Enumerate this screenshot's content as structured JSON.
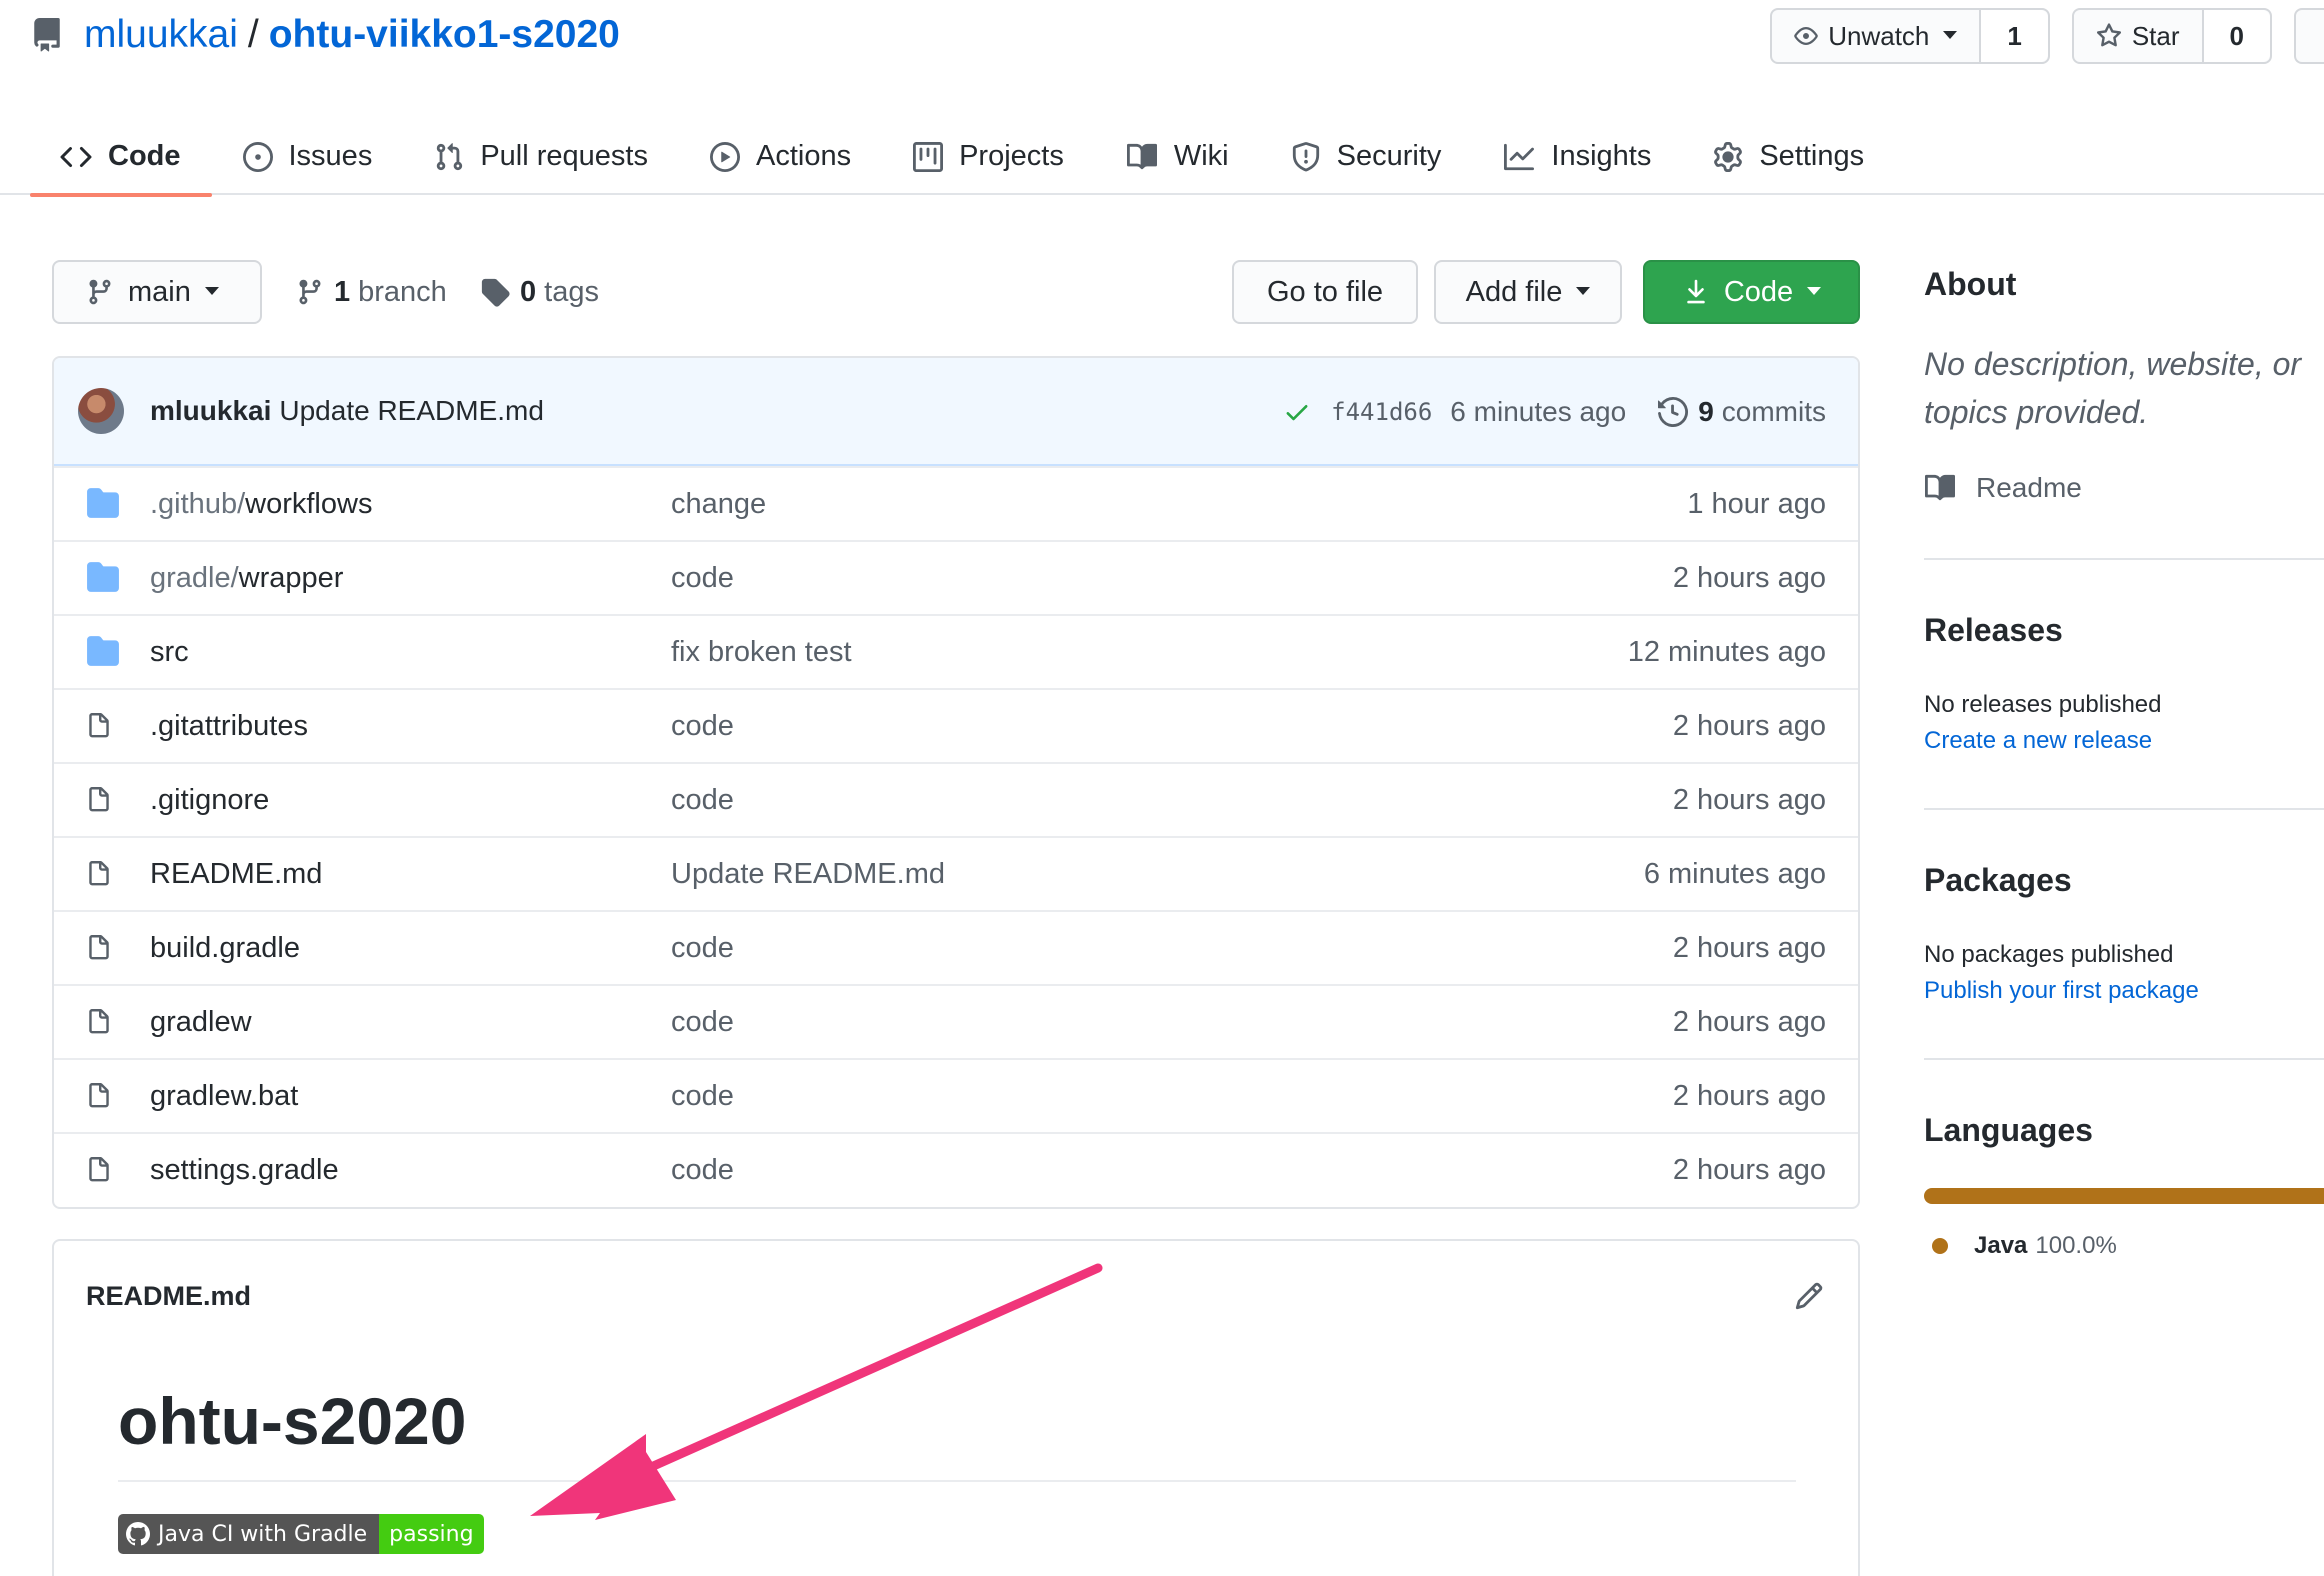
{
  "colors": {
    "link": "#0366d6",
    "primary_button": "#2ea44f",
    "tab_underline": "#f9826c",
    "commit_bar": "#f1f8ff",
    "folder_icon": "#79b8ff",
    "java": "#b07219",
    "badge_pass": "#44cc11",
    "annotation_arrow": "#f0357a"
  },
  "repo": {
    "owner": "mluukkai",
    "separator": "/",
    "name": "ohtu-viikko1-s2020"
  },
  "header_actions": {
    "watch_label": "Unwatch",
    "watch_count": "1",
    "star_label": "Star",
    "star_count": "0"
  },
  "tabs": [
    {
      "label": "Code",
      "icon": "code-icon",
      "selected": true
    },
    {
      "label": "Issues",
      "icon": "issue-icon"
    },
    {
      "label": "Pull requests",
      "icon": "pull-request-icon"
    },
    {
      "label": "Actions",
      "icon": "play-icon"
    },
    {
      "label": "Projects",
      "icon": "project-icon"
    },
    {
      "label": "Wiki",
      "icon": "book-icon"
    },
    {
      "label": "Security",
      "icon": "shield-icon"
    },
    {
      "label": "Insights",
      "icon": "graph-icon"
    },
    {
      "label": "Settings",
      "icon": "gear-icon"
    }
  ],
  "toolbar": {
    "branch": "main",
    "branch_count": "1",
    "branch_word": "branch",
    "tag_count": "0",
    "tag_word": "tags",
    "go_to_file": "Go to file",
    "add_file": "Add file",
    "code": "Code"
  },
  "latest_commit": {
    "author": "mluukkai",
    "message": "Update README.md",
    "sha": "f441d66",
    "age": "6 minutes ago",
    "commit_count": "9",
    "commit_word": "commits"
  },
  "files": [
    {
      "type": "dir",
      "prefix": ".github/",
      "name": "workflows",
      "message": "change",
      "age": "1 hour ago"
    },
    {
      "type": "dir",
      "prefix": "gradle/",
      "name": "wrapper",
      "message": "code",
      "age": "2 hours ago"
    },
    {
      "type": "dir",
      "prefix": "",
      "name": "src",
      "message": "fix broken test",
      "age": "12 minutes ago"
    },
    {
      "type": "file",
      "prefix": "",
      "name": ".gitattributes",
      "message": "code",
      "age": "2 hours ago"
    },
    {
      "type": "file",
      "prefix": "",
      "name": ".gitignore",
      "message": "code",
      "age": "2 hours ago"
    },
    {
      "type": "file",
      "prefix": "",
      "name": "README.md",
      "message": "Update README.md",
      "age": "6 minutes ago"
    },
    {
      "type": "file",
      "prefix": "",
      "name": "build.gradle",
      "message": "code",
      "age": "2 hours ago"
    },
    {
      "type": "file",
      "prefix": "",
      "name": "gradlew",
      "message": "code",
      "age": "2 hours ago"
    },
    {
      "type": "file",
      "prefix": "",
      "name": "gradlew.bat",
      "message": "code",
      "age": "2 hours ago"
    },
    {
      "type": "file",
      "prefix": "",
      "name": "settings.gradle",
      "message": "code",
      "age": "2 hours ago"
    }
  ],
  "readme": {
    "filename": "README.md",
    "heading": "ohtu-s2020",
    "badge_label": "Java CI with Gradle",
    "badge_status": "passing"
  },
  "sidebar": {
    "about_title": "About",
    "about_description": "No description, website, or topics provided.",
    "readme_link": "Readme",
    "releases_title": "Releases",
    "releases_note": "No releases published",
    "releases_link": "Create a new release",
    "packages_title": "Packages",
    "packages_note": "No packages published",
    "packages_link": "Publish your first package",
    "languages_title": "Languages",
    "languages": [
      {
        "name": "Java",
        "percent": "100.0%",
        "share": 1.0
      }
    ]
  }
}
